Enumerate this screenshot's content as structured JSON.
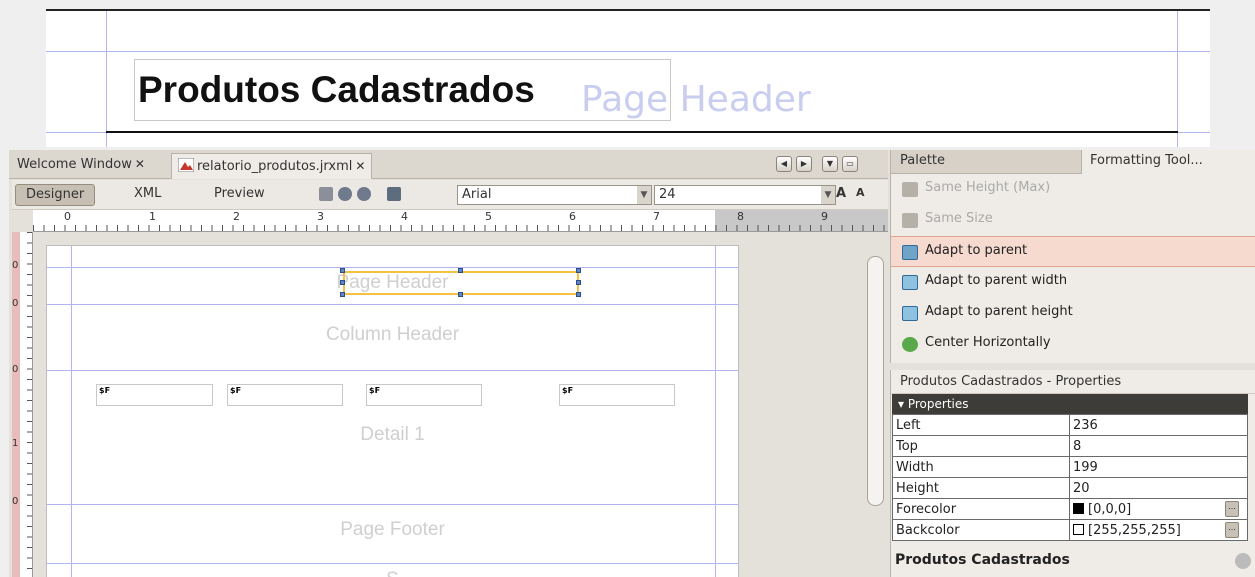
{
  "zoom": {
    "title": "Produtos Cadastrados",
    "band_label_ghost": "Page Header"
  },
  "tabs": [
    {
      "label": "Welcome Window"
    },
    {
      "label": "relatorio_produtos.jrxml"
    }
  ],
  "toolbar": {
    "designer_label": "Designer",
    "xml_label": "XML",
    "preview_label": "Preview",
    "font_family": "Arial",
    "font_size": "24"
  },
  "ruler": {
    "h_numbers": [
      "0",
      "1",
      "2",
      "3",
      "4",
      "5",
      "6",
      "7",
      "8",
      "9"
    ],
    "v_numbers": [
      "0",
      "0",
      "0",
      "1",
      "0"
    ]
  },
  "report": {
    "bands": [
      "Page Header",
      "Column Header",
      "Detail 1",
      "Page Footer",
      "S"
    ],
    "fields": [
      "$F",
      "$F",
      "$F",
      "$F"
    ]
  },
  "palette": {
    "tab_palette": "Palette",
    "tab_formatting": "Formatting Tool...",
    "items": [
      {
        "label": "Same Height (Max)",
        "enabled": false,
        "icon": "same-height-icon"
      },
      {
        "label": "Same Size",
        "enabled": false,
        "icon": "same-size-icon"
      },
      {
        "label": "Adapt to parent",
        "enabled": true,
        "highlight": true,
        "icon": "adapt-parent-icon"
      },
      {
        "label": "Adapt to parent width",
        "enabled": true,
        "icon": "adapt-width-icon"
      },
      {
        "label": "Adapt to parent height",
        "enabled": true,
        "icon": "adapt-height-icon"
      },
      {
        "label": "Center Horizontally",
        "enabled": true,
        "icon": "center-horizontal-icon"
      }
    ]
  },
  "properties": {
    "title": "Produtos Cadastrados - Properties",
    "section": "Properties",
    "rows": [
      {
        "key": "Left",
        "value": "236"
      },
      {
        "key": "Top",
        "value": "8"
      },
      {
        "key": "Width",
        "value": "199"
      },
      {
        "key": "Height",
        "value": "20"
      },
      {
        "key": "Forecolor",
        "value": "[0,0,0]"
      },
      {
        "key": "Backcolor",
        "value": "[255,255,255]"
      }
    ],
    "footer": "Produtos Cadastrados"
  },
  "colors": {
    "selection": "#f5c240",
    "highlight": "#f6d9cf",
    "band_guide": "#b4b4f0"
  }
}
